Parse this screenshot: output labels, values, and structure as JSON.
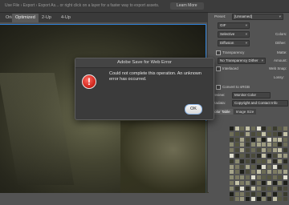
{
  "infobar": {
    "hint": "Use File › Export › Export As... or right click on a layer for a faster way to export assets.",
    "learn_more": "Learn More"
  },
  "tabs": [
    {
      "label": "Original"
    },
    {
      "label": "Optimized",
      "active": true
    },
    {
      "label": "2-Up"
    },
    {
      "label": "4-Up"
    }
  ],
  "panel": {
    "preset_label": "Preset:",
    "preset_value": "[Unnamed]",
    "format_value": "GIF",
    "reduction_value": "Selective",
    "dither_value": "Diffusion",
    "colors_label": "Colors:",
    "dither_label": "Dither:",
    "transparency_label": "Transparency",
    "matte_label": "Matte:",
    "transparency_dither_value": "No Transparency Dither",
    "amount_label": "Amount:",
    "interlaced_label": "Interlaced",
    "websnap_label": "Web Snap:",
    "lossy_label": "Lossy:",
    "convert_srgb_label": "Convert to sRGB",
    "preview_label": "Preview:",
    "preview_value": "Monitor Color",
    "metadata_label": "Metadata:",
    "metadata_value": "Copyright and Contact Info",
    "panel_tabs": [
      "Color Table",
      "Image Size"
    ],
    "color_table_label": "Color Table"
  },
  "dialog": {
    "title": "Adobe Save for Web Error",
    "message": "Could not complete this operation. An unknown error has occurred.",
    "ok_label": "OK",
    "icon": "error-icon"
  },
  "colors": {
    "accent": "#2d7fd6",
    "error_red": "#d42a20"
  }
}
